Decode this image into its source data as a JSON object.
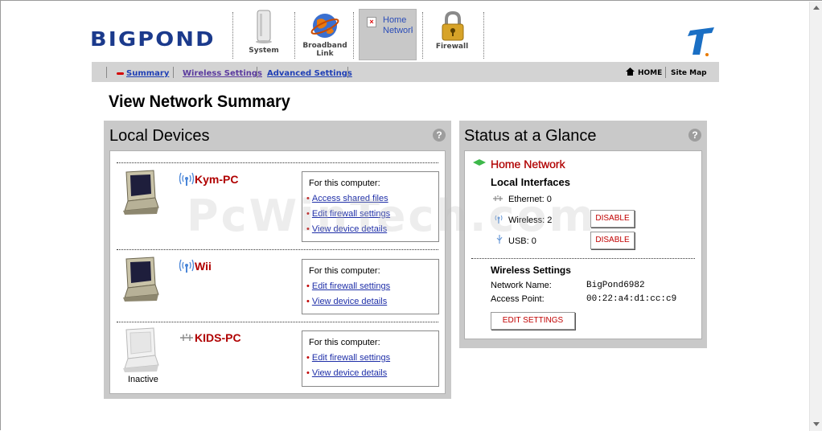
{
  "brand": {
    "logo_text": "BIGPOND"
  },
  "tabs": [
    {
      "label": "System"
    },
    {
      "label_line1": "Broadband",
      "label_line2": "Link"
    },
    {
      "label_line1": "Home",
      "label_line2": "Network"
    },
    {
      "label": "Firewall"
    }
  ],
  "nav": {
    "summary": "Summary",
    "wireless": "Wireless Settings",
    "advanced": "Advanced Settings",
    "home": "HOME",
    "sitemap": "Site Map"
  },
  "page_title": "View Network Summary",
  "local_devices": {
    "title": "Local Devices",
    "help": "?",
    "devices": [
      {
        "name": "Kym-PC",
        "box_title": "For this computer:",
        "links": [
          "Access shared files",
          "Edit firewall settings",
          "View device details"
        ]
      },
      {
        "name": "Wii",
        "box_title": "For this computer:",
        "links": [
          "Edit firewall settings",
          "View device details"
        ]
      },
      {
        "name": "KIDS-PC",
        "status": "Inactive",
        "box_title": "For this computer:",
        "links": [
          "Edit firewall settings",
          "View device details"
        ]
      }
    ]
  },
  "status": {
    "title": "Status at a Glance",
    "help": "?",
    "home_network": "Home Network",
    "local_interfaces": "Local Interfaces",
    "ethernet": "Ethernet: 0",
    "wireless": "Wireless: 2",
    "usb": "USB: 0",
    "disable_label": "DISABLE",
    "wireless_settings": "Wireless Settings",
    "network_name_label": "Network Name:",
    "network_name_value": "BigPond6982",
    "access_point_label": "Access Point:",
    "access_point_value": "00:22:a4:d1:cc:c9",
    "edit_button": "EDIT SETTINGS"
  },
  "watermark": "PcWinTech.com",
  "colors": {
    "accent_red": "#b00000",
    "link_blue": "#1f2fa8",
    "panel_gray": "#c9c9c9",
    "brand_blue": "#1b3a8c"
  }
}
